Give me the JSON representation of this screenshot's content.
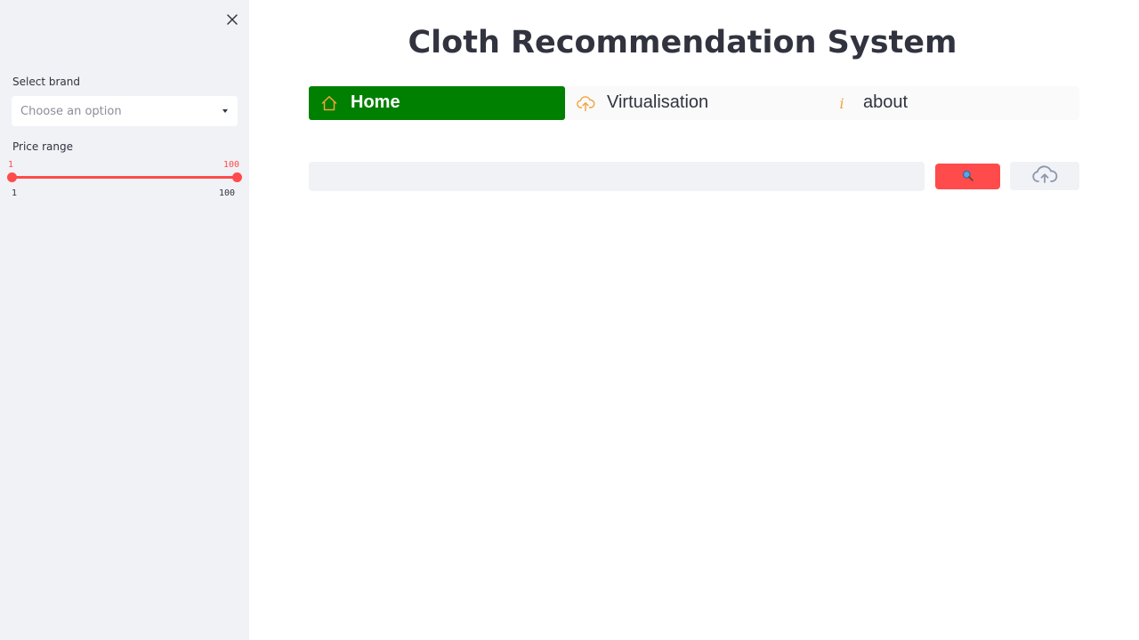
{
  "sidebar": {
    "close_icon": "close-icon",
    "brand_label": "Select brand",
    "brand_placeholder": "Choose an option",
    "price_label": "Price range",
    "price_range": {
      "min_value": "1",
      "max_value": "100",
      "min_tick": "1",
      "max_tick": "100"
    }
  },
  "main": {
    "title": "Cloth Recommendation System",
    "nav": [
      {
        "label": "Home",
        "icon": "home-icon",
        "active": true
      },
      {
        "label": "Virtualisation",
        "icon": "cloud-upload-icon",
        "active": false
      },
      {
        "label": "about",
        "icon": "info-icon",
        "active": false
      }
    ],
    "search": {
      "value": "",
      "button_icon": "search-icon"
    },
    "upload_icon": "cloud-upload-icon"
  },
  "colors": {
    "accent": "#ff4b4b",
    "nav_active": "#008000",
    "nav_icon": "#f0a23a",
    "sidebar_bg": "#f0f2f6"
  }
}
